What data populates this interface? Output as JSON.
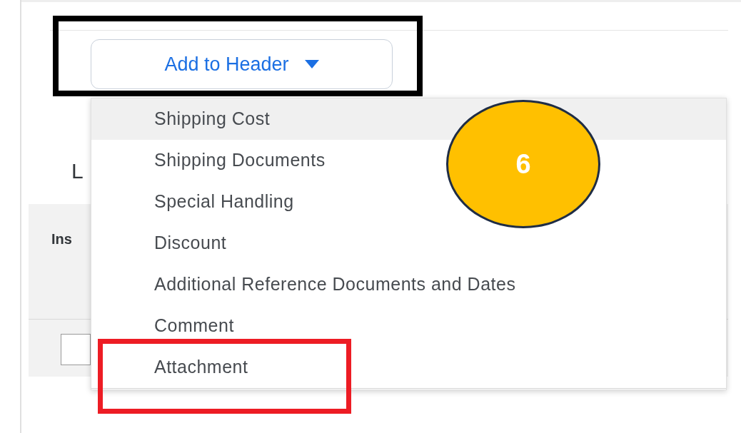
{
  "button": {
    "label": "Add to Header"
  },
  "background": {
    "heading": "L",
    "table_header": "Ins"
  },
  "menu": {
    "items": [
      {
        "label": "Shipping Cost",
        "selected": true
      },
      {
        "label": "Shipping Documents",
        "selected": false
      },
      {
        "label": "Special Handling",
        "selected": false
      },
      {
        "label": "Discount",
        "selected": false
      },
      {
        "label": "Additional Reference Documents and Dates",
        "selected": false
      },
      {
        "label": "Comment",
        "selected": false
      },
      {
        "label": "Attachment",
        "selected": false
      }
    ]
  },
  "checkbox": {
    "checked": false
  },
  "callout": {
    "step": "6"
  }
}
